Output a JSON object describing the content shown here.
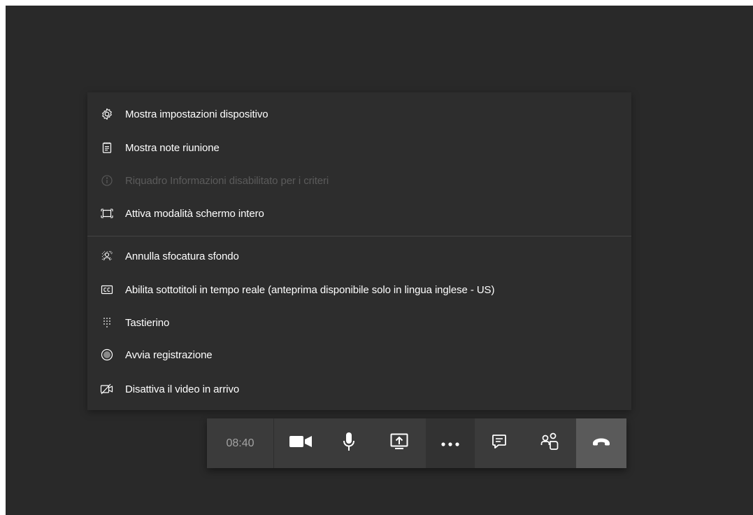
{
  "menu": {
    "items": [
      {
        "label": "Mostra impostazioni dispositivo",
        "icon": "gear-icon",
        "enabled": true
      },
      {
        "label": "Mostra note riunione",
        "icon": "notes-icon",
        "enabled": true
      },
      {
        "label": "Riquadro Informazioni disabilitato per i criteri",
        "icon": "info-icon",
        "enabled": false
      },
      {
        "label": "Attiva modalità schermo intero",
        "icon": "fullscreen-icon",
        "enabled": true
      },
      {
        "label": "Annulla sfocatura sfondo",
        "icon": "blur-background-icon",
        "enabled": true
      },
      {
        "label": "Abilita sottotitoli in tempo reale (anteprima disponibile solo in lingua inglese - US)",
        "icon": "closed-captions-icon",
        "enabled": true
      },
      {
        "label": "Tastierino",
        "icon": "dialpad-icon",
        "enabled": true
      },
      {
        "label": "Avvia registrazione",
        "icon": "record-icon",
        "enabled": true
      },
      {
        "label": "Disattiva il video in arrivo",
        "icon": "video-off-icon",
        "enabled": true
      }
    ]
  },
  "toolbar": {
    "time": "08:40",
    "buttons": [
      "camera-icon",
      "microphone-icon",
      "share-screen-icon",
      "more-options-icon",
      "chat-icon",
      "participants-icon",
      "hang-up-icon"
    ]
  },
  "colors": {
    "background": "#292929",
    "menu": "#2d2d2d",
    "toolbar": "#3b3b3b",
    "hangup": "#5a5a5a",
    "text": "#ffffff",
    "disabled_text": "#5b5b5b"
  }
}
